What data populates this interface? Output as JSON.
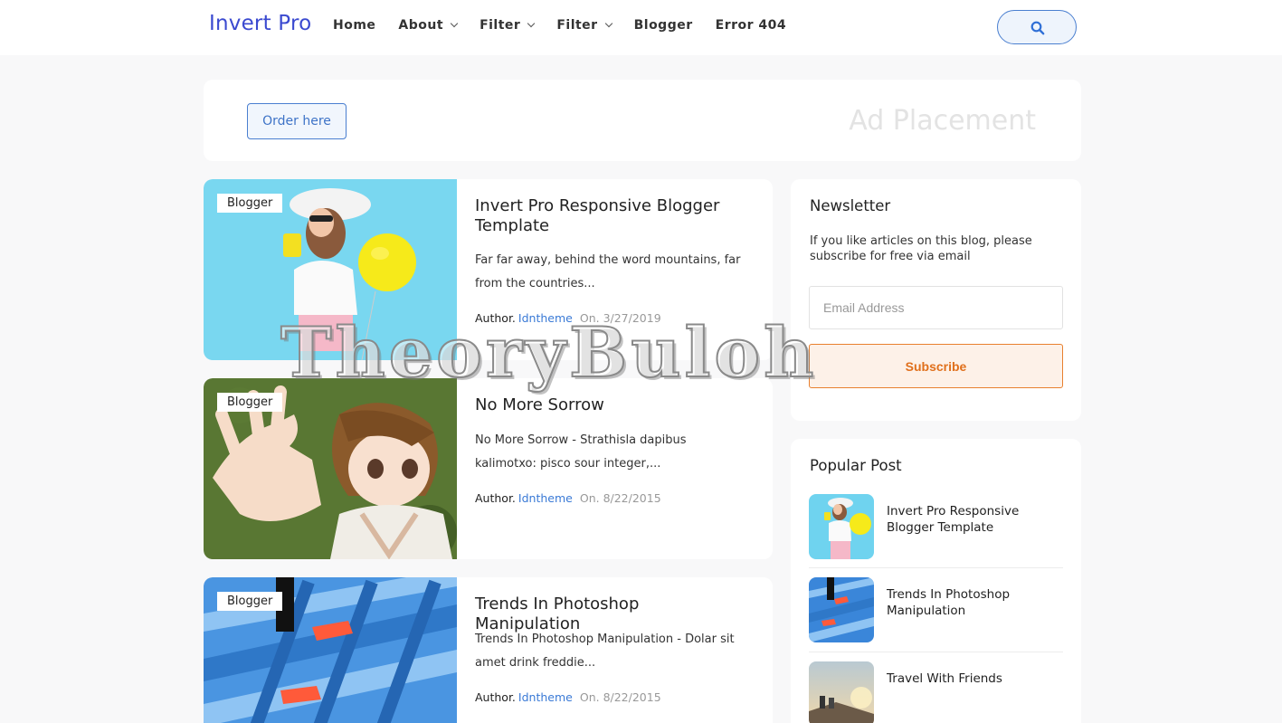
{
  "header": {
    "logo": "Invert Pro",
    "nav": [
      {
        "label": "Home",
        "dropdown": false
      },
      {
        "label": "About",
        "dropdown": true
      },
      {
        "label": "Filter",
        "dropdown": true
      },
      {
        "label": "Filter",
        "dropdown": true
      },
      {
        "label": "Blogger",
        "dropdown": false
      },
      {
        "label": "Error 404",
        "dropdown": false
      }
    ]
  },
  "ad": {
    "button_label": "Order here",
    "text": "Ad Placement"
  },
  "posts": [
    {
      "label": "Blogger",
      "title": "Invert Pro Responsive Blogger Template",
      "excerpt": "Far far away, behind the word mountains, far from the countries...",
      "author_prefix": "Author.",
      "author": "Idntheme",
      "date": "On. 3/27/2019"
    },
    {
      "label": "Blogger",
      "title": "No More Sorrow",
      "excerpt": "No More Sorrow - Strathisla dapibus kalimotxo: pisco sour integer,...",
      "author_prefix": "Author.",
      "author": "Idntheme",
      "date": "On. 8/22/2015"
    },
    {
      "label": "Blogger",
      "title": "Trends In Photoshop Manipulation",
      "excerpt": "Trends In Photoshop Manipulation - Dolar sit amet drink freddie...",
      "author_prefix": "Author.",
      "author": "Idntheme",
      "date": "On. 8/22/2015"
    }
  ],
  "newsletter": {
    "title": "Newsletter",
    "description": "If you like articles on this blog, please subscribe for free via email",
    "email_placeholder": "Email Address",
    "subscribe_label": "Subscribe"
  },
  "popular": {
    "title": "Popular Post",
    "items": [
      {
        "title": "Invert Pro Responsive Blogger Template"
      },
      {
        "title": "Trends In Photoshop Manipulation"
      },
      {
        "title": "Travel With Friends"
      }
    ]
  },
  "watermark": "TheoryBuloh",
  "colors": {
    "accent": "#3b4ad0",
    "link": "#3a7ad6",
    "subscribe": "#e0701c"
  }
}
